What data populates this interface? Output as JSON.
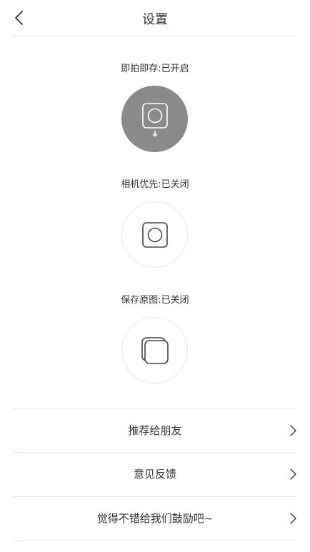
{
  "header": {
    "title": "设置",
    "back_icon": "chevron-left-icon"
  },
  "toggles": [
    {
      "label": "即拍即存:已开启",
      "state": "on",
      "icon": "save-on-capture-icon"
    },
    {
      "label": "相机优先:已关闭",
      "state": "off",
      "icon": "camera-priority-icon"
    },
    {
      "label": "保存原图:已关闭",
      "state": "off",
      "icon": "save-original-icon"
    }
  ],
  "menu": [
    {
      "label": "推荐给朋友",
      "icon": "chevron-right-icon"
    },
    {
      "label": "意见反馈",
      "icon": "chevron-right-icon"
    },
    {
      "label": "觉得不错给我们鼓励吧~",
      "icon": "chevron-right-icon"
    }
  ],
  "colors": {
    "toggle_on_bg": "#8a8a8a",
    "divider": "#e6e6e6",
    "text": "#333333"
  }
}
